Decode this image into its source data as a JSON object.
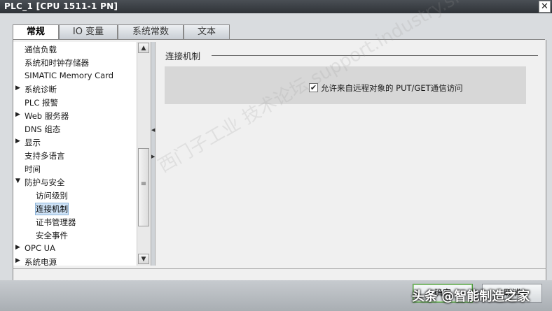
{
  "window": {
    "title": "PLC_1 [CPU 1511-1 PN]",
    "close_glyph": "✕"
  },
  "tabs": [
    {
      "label": "常规",
      "active": true
    },
    {
      "label": "IO 变量",
      "active": false
    },
    {
      "label": "系统常数",
      "active": false
    },
    {
      "label": "文本",
      "active": false
    }
  ],
  "nav": {
    "items": [
      {
        "label": "通信负载",
        "expander": "",
        "indent": 0
      },
      {
        "label": "系统和时钟存储器",
        "expander": "",
        "indent": 0
      },
      {
        "label": "SIMATIC Memory Card",
        "expander": "",
        "indent": 0
      },
      {
        "label": "系统诊断",
        "expander": "▶",
        "indent": 0
      },
      {
        "label": "PLC 报警",
        "expander": "",
        "indent": 0
      },
      {
        "label": "Web 服务器",
        "expander": "▶",
        "indent": 0
      },
      {
        "label": "DNS 组态",
        "expander": "",
        "indent": 0
      },
      {
        "label": "显示",
        "expander": "▶",
        "indent": 0
      },
      {
        "label": "支持多语言",
        "expander": "",
        "indent": 0
      },
      {
        "label": "时间",
        "expander": "",
        "indent": 0
      },
      {
        "label": "防护与安全",
        "expander": "▼",
        "indent": 0
      },
      {
        "label": "访问级别",
        "expander": "",
        "indent": 1
      },
      {
        "label": "连接机制",
        "expander": "",
        "indent": 1,
        "selected": true
      },
      {
        "label": "证书管理器",
        "expander": "",
        "indent": 1
      },
      {
        "label": "安全事件",
        "expander": "",
        "indent": 1
      },
      {
        "label": "OPC UA",
        "expander": "▶",
        "indent": 0
      },
      {
        "label": "系统电源",
        "expander": "▶",
        "indent": 0
      }
    ],
    "scroll_up": "▲",
    "scroll_down": "▼",
    "thumb_grip": "≡"
  },
  "splitter": {
    "left_arrow": "◀",
    "right_arrow": "▶"
  },
  "section": {
    "title": "连接机制",
    "checkbox": {
      "checked": true,
      "mark": "✔",
      "label": "允许来自远程对象的 PUT/GET通信访问"
    }
  },
  "buttons": {
    "ok_label": "确定",
    "cancel_label": "取消"
  },
  "watermarks": {
    "diagonal": "西门子工业 技术论坛 support.industry.siemens.com/cs",
    "corner": "头条 @智能制造之家"
  }
}
